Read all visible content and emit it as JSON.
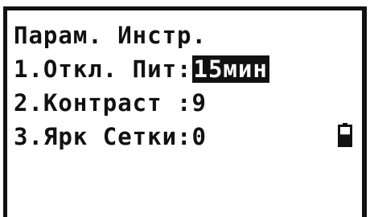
{
  "menu": {
    "title": "Парам. Инстр.",
    "items": [
      {
        "label": "1.Откл. Пит:",
        "value": "15мин"
      },
      {
        "label": "2.Контраст :",
        "value": "9"
      },
      {
        "label": "3.Ярк Сетки:",
        "value": "0"
      }
    ]
  },
  "status": {
    "battery_icon": "battery-icon",
    "battery_level": 0.55
  },
  "colors": {
    "foreground": "#111111",
    "background": "#ffffff",
    "highlight_text": "#ffffff"
  }
}
